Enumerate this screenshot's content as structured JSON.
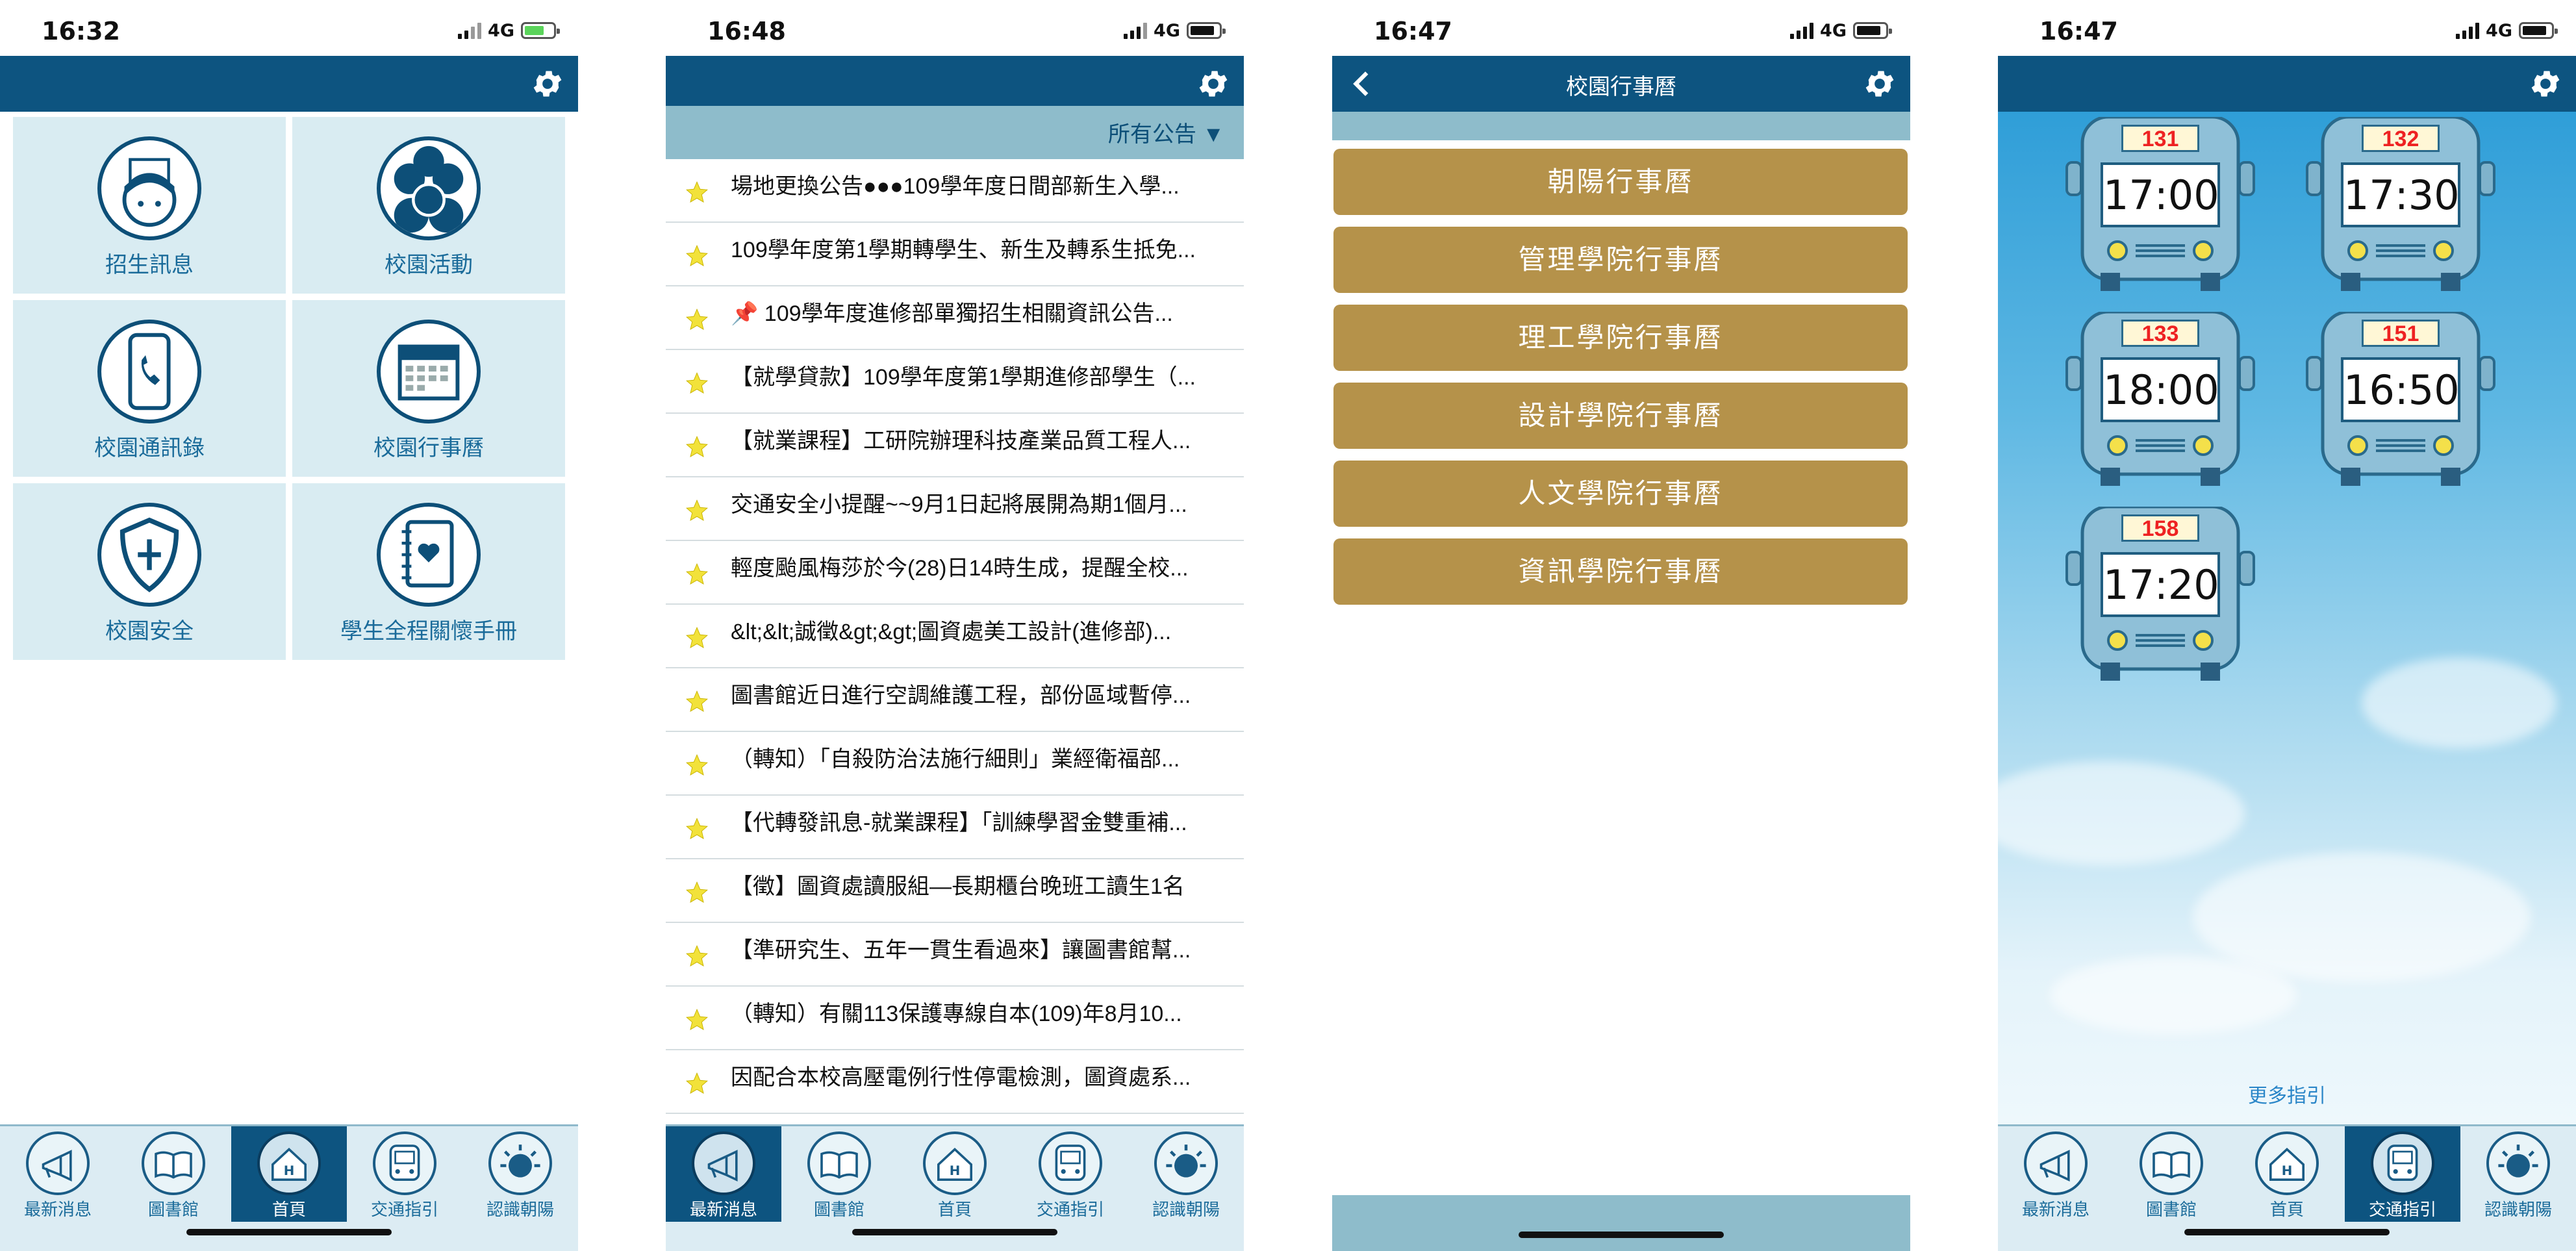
{
  "screens": {
    "home": {
      "status": {
        "time": "16:32",
        "network": "4G"
      },
      "tiles": [
        {
          "label": "招生訊息",
          "icon": "student-face-icon"
        },
        {
          "label": "校園活動",
          "icon": "group-people-icon"
        },
        {
          "label": "校園通訊錄",
          "icon": "phone-icon"
        },
        {
          "label": "校園行事曆",
          "icon": "calendar-icon"
        },
        {
          "label": "校園安全",
          "icon": "shield-icon"
        },
        {
          "label": "學生全程關懷手冊",
          "icon": "heart-notebook-icon"
        }
      ]
    },
    "news": {
      "status": {
        "time": "16:48",
        "network": "4G"
      },
      "filter_label": "所有公告 ▼",
      "items": [
        "場地更換公告●●●109學年度日間部新生入學...",
        "109學年度第1學期轉學生、新生及轉系生抵免...",
        "📌 109學年度進修部單獨招生相關資訊公告...",
        "【就學貸款】109學年度第1學期進修部學生（...",
        "【就業課程】工研院辦理科技產業品質工程人...",
        "交通安全小提醒~~9月1日起將展開為期1個月...",
        "輕度颱風梅莎於今(28)日14時生成，提醒全校...",
        "&lt;&lt;誠徵&gt;&gt;圖資處美工設計(進修部)...",
        "圖書館近日進行空調維護工程，部份區域暫停...",
        "（轉知）「自殺防治法施行細則」業經衛福部...",
        "【代轉發訊息-就業課程】「訓練學習金雙重補...",
        "【徵】圖資處讀服組—長期櫃台晚班工讀生1名",
        "【準研究生、五年一貫生看過來】讓圖書館幫...",
        "（轉知）有關113保護專線自本(109)年8月10...",
        "因配合本校高壓電例行性停電檢測，圖資處系..."
      ]
    },
    "calendar": {
      "status": {
        "time": "16:47",
        "network": "4G"
      },
      "title": "校園行事曆",
      "buttons": [
        "朝陽行事曆",
        "管理學院行事曆",
        "理工學院行事曆",
        "設計學院行事曆",
        "人文學院行事曆",
        "資訊學院行事曆"
      ]
    },
    "transport": {
      "status": {
        "time": "16:47",
        "network": "4G"
      },
      "buses": [
        {
          "number": "131",
          "time": "17:00"
        },
        {
          "number": "132",
          "time": "17:30"
        },
        {
          "number": "133",
          "time": "18:00"
        },
        {
          "number": "151",
          "time": "16:50"
        },
        {
          "number": "158",
          "time": "17:20"
        }
      ],
      "more_link": "更多指引"
    }
  },
  "tabbar": [
    {
      "label": "最新消息",
      "icon": "megaphone-icon"
    },
    {
      "label": "圖書館",
      "icon": "book-icon"
    },
    {
      "label": "首頁",
      "icon": "home-icon"
    },
    {
      "label": "交通指引",
      "icon": "bus-icon"
    },
    {
      "label": "認識朝陽",
      "icon": "sun-icon"
    }
  ],
  "active_tabs": {
    "home": 2,
    "news": 0,
    "transport": 3
  },
  "colors": {
    "primary": "#0d5480",
    "tile_bg": "#d9ecf2",
    "calendar_button": "#b5924a",
    "filter_bar": "#8ebccb",
    "bus_number": "#ee2222"
  }
}
